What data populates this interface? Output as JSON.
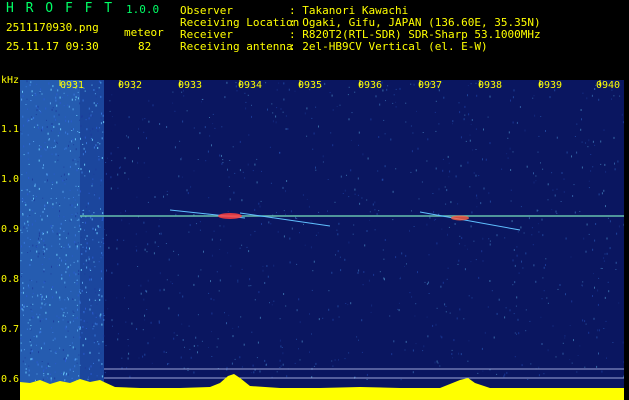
{
  "app": {
    "name": "H R O F F T",
    "version": "1.0.0",
    "filename": "2511170930.png",
    "datetime": "25.11.17 09:30",
    "meteor_label": "meteor",
    "meteor_count": "82"
  },
  "info": {
    "rows": [
      {
        "label": "Observer",
        "value": ": Takanori Kawachi"
      },
      {
        "label": "Receiving Location",
        "value": ": Ogaki, Gifu, JAPAN (136.60E, 35.35N)"
      },
      {
        "label": "Receiver",
        "value": ": R820T2(RTL-SDR) SDR-Sharp 53.1000MHz"
      },
      {
        "label": "Receiving antenna",
        "value": ": 2el-HB9CV Vertical (el. E-W)"
      }
    ]
  },
  "axis": {
    "y_unit": "kHz",
    "y_ticks": [
      "1.1",
      "1.0",
      "0.9",
      "0.8",
      "0.7",
      "0.6"
    ],
    "x_ticks": [
      "0931",
      "0932",
      "0933",
      "0934",
      "0935",
      "0936",
      "0937",
      "0938",
      "0939",
      "0940"
    ]
  },
  "colors": {
    "background": "#000000",
    "label": "#ffff00",
    "title": "#00ff66",
    "spectrum_bg": "#0a1660",
    "carrier": "#40d8c8",
    "histogram": "#ffff00"
  }
}
